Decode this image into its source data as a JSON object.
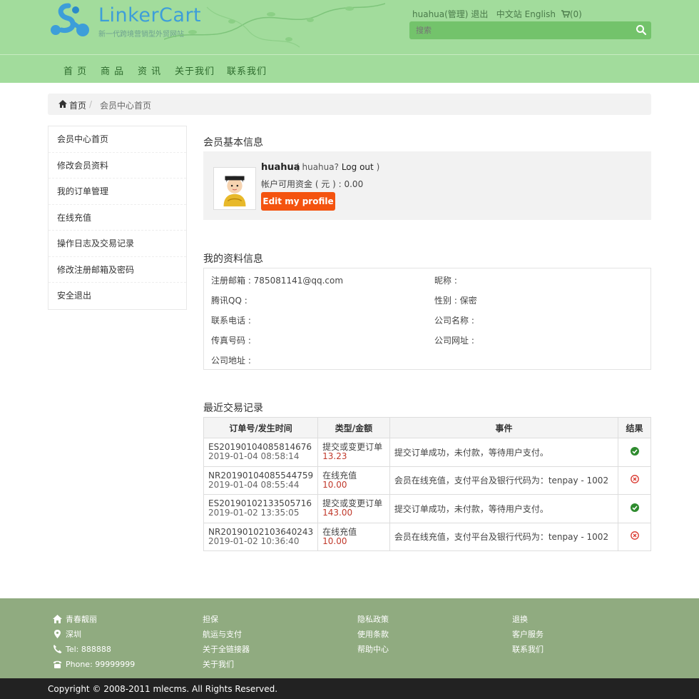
{
  "header": {
    "logo_text": "LinkerCart",
    "logo_sub": "新一代跨境营销型外贸网站",
    "user_link": "huahua(管理)",
    "logout_link": "退出",
    "lang_cn": "中文站",
    "lang_en": "English",
    "cart_open": "(",
    "cart_count": "0",
    "cart_close": ")",
    "search_placeholder": "搜索"
  },
  "nav": [
    "首 页",
    "商 品",
    "资 讯",
    "关于我们",
    "联系我们"
  ],
  "breadcrumb": {
    "home": "首页",
    "sep": "/",
    "current": "会员中心首页"
  },
  "sidebar": [
    "会员中心首页",
    "修改会员资料",
    "我的订单管理",
    "在线充值",
    "操作日志及交易记录",
    "修改注册邮箱及密码",
    "安全退出"
  ],
  "member": {
    "section_title": "会员基本信息",
    "username": "huahua",
    "open": "( huahua?",
    "logout": "Log out",
    "close": ")",
    "funds": "帐户可用资金 ( 元 ) : 0.00",
    "edit_button": "Edit my profile"
  },
  "profile": {
    "section_title": "我的资料信息",
    "email": "注册邮箱 : 785081141@qq.com",
    "nickname": "昵称 :",
    "qq": "腾讯QQ :",
    "gender": "性别 : 保密",
    "phone": "联系电话 :",
    "company": "公司名称 :",
    "fax": "传真号码 :",
    "website": "公司网址 :",
    "address": "公司地址 :"
  },
  "transactions": {
    "section_title": "最近交易记录",
    "headers": [
      "订单号/发生时间",
      "类型/金额",
      "事件",
      "结果"
    ],
    "rows": [
      {
        "order": "ES20190104085814676",
        "time": "2019-01-04 08:58:14",
        "type": "提交或变更订单",
        "amount": "13.23",
        "event": "提交订单成功，未付款，等待用户支付。",
        "result": "success"
      },
      {
        "order": "NR20190104085544759",
        "time": "2019-01-04 08:55:44",
        "type": "在线充值",
        "amount": "10.00",
        "event": "会员在线充值，支付平台及银行代码为：tenpay - 1002",
        "result": "fail"
      },
      {
        "order": "ES20190102133505716",
        "time": "2019-01-02 13:35:05",
        "type": "提交或变更订单",
        "amount": "143.00",
        "event": "提交订单成功，未付款，等待用户支付。",
        "result": "success"
      },
      {
        "order": "NR20190102103640243",
        "time": "2019-01-02 10:36:40",
        "type": "在线充值",
        "amount": "10.00",
        "event": "会员在线充值，支付平台及银行代码为：tenpay - 1002",
        "result": "fail"
      }
    ]
  },
  "footer": {
    "col1": [
      "青春靓丽",
      "深圳",
      "Tel: 888888",
      "Phone: 99999999"
    ],
    "col2": [
      "担保",
      "航运与支付",
      "关于全链接器",
      "关于我们"
    ],
    "col3": [
      "隐私政策",
      "使用条款",
      "帮助中心"
    ],
    "col4": [
      "退换",
      "客户服务",
      "联系我们"
    ],
    "copyright": "Copyright © 2008-2011 mlecms. All Rights Reserved."
  },
  "colors": {
    "header_bg": "#a2dc9c",
    "footer_bg": "#90ab80",
    "accent_orange": "#f4530f",
    "success": "#2e8b2e",
    "fail": "#d9342b"
  }
}
